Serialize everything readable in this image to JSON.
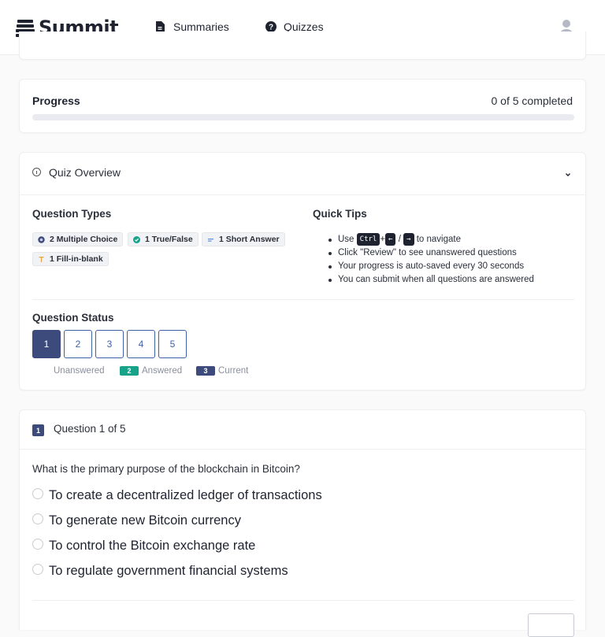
{
  "brand": {
    "name": "Summit",
    "icon": "stack-icon"
  },
  "nav": [
    {
      "label": "Summaries",
      "icon": "document-icon"
    },
    {
      "label": "Quizzes",
      "icon": "question-circle-icon"
    }
  ],
  "user": {
    "icon": "user-avatar-icon"
  },
  "progress": {
    "title": "Progress",
    "count_text": "0 of 5 completed",
    "fraction": 0.0
  },
  "overview": {
    "title": "Quiz Overview",
    "question_types_title": "Question Types",
    "question_types": [
      {
        "label": "2 Multiple Choice",
        "icon": "layers-icon",
        "color": "#3d4a7c"
      },
      {
        "label": "1 True/False",
        "icon": "check-circle-icon",
        "color": "#16a38a"
      },
      {
        "label": "1 Short Answer",
        "icon": "short-text-icon",
        "color": "#5b8dd9"
      },
      {
        "label": "1 Fill-in-blank",
        "icon": "text-cursor-icon",
        "color": "#e8a33c"
      }
    ],
    "quick_tips_title": "Quick Tips",
    "tips": {
      "nav_prefix": "Use",
      "nav_key_ctrl": "Ctrl",
      "nav_plus": "+",
      "nav_key_left": "←",
      "nav_slash": "/",
      "nav_key_right": "→",
      "nav_suffix": "to navigate",
      "review": "Click \"Review\" to see unanswered questions",
      "autosave": "Your progress is auto-saved every 30 seconds",
      "submit": "You can submit when all questions are answered"
    },
    "status_title": "Question Status",
    "question_numbers": [
      "1",
      "2",
      "3",
      "4",
      "5"
    ],
    "current_question": "1",
    "legend": {
      "unanswered": "Unanswered",
      "answered_badge": "2",
      "answered": "Answered",
      "current_badge": "3",
      "current": "Current"
    }
  },
  "question": {
    "badge": "1",
    "header": "Question 1 of 5",
    "text": "What is the primary purpose of the blockchain in Bitcoin?",
    "options": [
      "To create a decentralized ledger of transactions",
      "To generate new Bitcoin currency",
      "To control the Bitcoin exchange rate",
      "To regulate government financial systems"
    ]
  },
  "colors": {
    "primary": "#3d4a7c",
    "accent_blue": "#3d63a6",
    "success": "#16a38a",
    "text": "#2b2f3a"
  }
}
